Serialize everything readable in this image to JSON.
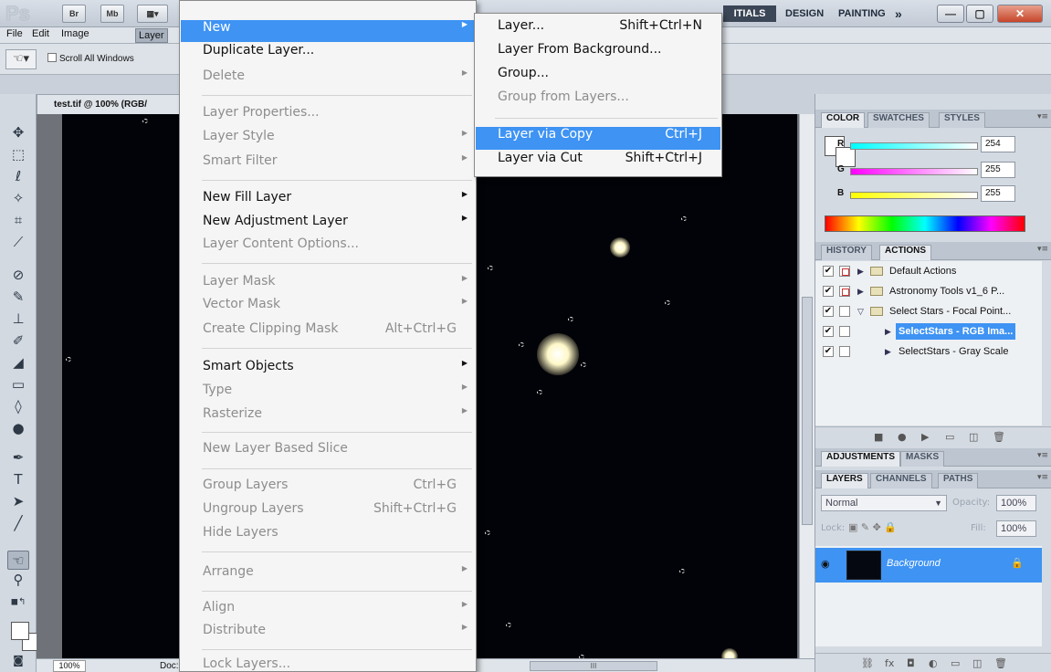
{
  "app": {
    "logo": "Ps",
    "bridge_label": "Br",
    "minibridge_label": "Mb",
    "workspaces": {
      "essentials": "ITIALS",
      "design": "DESIGN",
      "painting": "PAINTING",
      "more": "»"
    },
    "window_buttons": {
      "minimize": "—",
      "restore": "▢",
      "close": "✕"
    }
  },
  "menubar": {
    "items": [
      {
        "label": "File"
      },
      {
        "label": "Edit"
      },
      {
        "label": "Image"
      },
      {
        "label": "Layer"
      }
    ]
  },
  "options": {
    "scroll_all_windows": "Scroll All Windows"
  },
  "document": {
    "tab_title": "test.tif @ 100% (RGB/",
    "zoom": "100%",
    "doc_label": "Doc:",
    "scroll_label": "III"
  },
  "layer_menu": {
    "items": [
      {
        "label": "New",
        "enabled": true,
        "submenu": true,
        "highlighted": true
      },
      {
        "label": "Duplicate Layer...",
        "enabled": true
      },
      {
        "label": "Delete",
        "enabled": false,
        "submenu": true
      },
      {
        "label": "Layer Properties...",
        "enabled": false
      },
      {
        "label": "Layer Style",
        "enabled": false,
        "submenu": true
      },
      {
        "label": "Smart Filter",
        "enabled": false,
        "submenu": true
      },
      {
        "label": "New Fill Layer",
        "enabled": true,
        "submenu": true
      },
      {
        "label": "New Adjustment Layer",
        "enabled": true,
        "submenu": true
      },
      {
        "label": "Layer Content Options...",
        "enabled": false
      },
      {
        "label": "Layer Mask",
        "enabled": false,
        "submenu": true
      },
      {
        "label": "Vector Mask",
        "enabled": false,
        "submenu": true
      },
      {
        "label": "Create Clipping Mask",
        "enabled": false,
        "shortcut": "Alt+Ctrl+G"
      },
      {
        "label": "Smart Objects",
        "enabled": true,
        "submenu": true
      },
      {
        "label": "Type",
        "enabled": false,
        "submenu": true
      },
      {
        "label": "Rasterize",
        "enabled": false,
        "submenu": true
      },
      {
        "label": "New Layer Based Slice",
        "enabled": false
      },
      {
        "label": "Group Layers",
        "enabled": false,
        "shortcut": "Ctrl+G"
      },
      {
        "label": "Ungroup Layers",
        "enabled": false,
        "shortcut": "Shift+Ctrl+G"
      },
      {
        "label": "Hide Layers",
        "enabled": false
      },
      {
        "label": "Arrange",
        "enabled": false,
        "submenu": true
      },
      {
        "label": "Align",
        "enabled": false,
        "submenu": true
      },
      {
        "label": "Distribute",
        "enabled": false,
        "submenu": true
      },
      {
        "label": "Lock Layers...",
        "enabled": false
      }
    ]
  },
  "new_submenu": {
    "items": [
      {
        "label": "Layer...",
        "shortcut": "Shift+Ctrl+N",
        "enabled": true
      },
      {
        "label": "Layer From Background...",
        "enabled": true
      },
      {
        "label": "Group...",
        "enabled": true
      },
      {
        "label": "Group from Layers...",
        "enabled": false
      },
      {
        "label": "Layer via Copy",
        "shortcut": "Ctrl+J",
        "enabled": true,
        "highlighted": true
      },
      {
        "label": "Layer via Cut",
        "shortcut": "Shift+Ctrl+J",
        "enabled": true
      }
    ]
  },
  "color_panel": {
    "tabs": [
      "COLOR",
      "SWATCHES",
      "STYLES"
    ],
    "r": {
      "label": "R",
      "value": "254"
    },
    "g": {
      "label": "G",
      "value": "255"
    },
    "b": {
      "label": "B",
      "value": "255"
    }
  },
  "actions_panel": {
    "tabs": [
      "HISTORY",
      "ACTIONS"
    ],
    "rows": [
      {
        "label": "Default Actions"
      },
      {
        "label": "Astronomy Tools v1_6 P..."
      },
      {
        "label": "Select Stars - Focal Point..."
      },
      {
        "label": "SelectStars - RGB Ima..."
      },
      {
        "label": "SelectStars - Gray Scale"
      }
    ]
  },
  "adjustments_panel": {
    "tabs": [
      "ADJUSTMENTS",
      "MASKS"
    ]
  },
  "layers_panel": {
    "tabs": [
      "LAYERS",
      "CHANNELS",
      "PATHS"
    ],
    "blend_mode": "Normal",
    "opacity_label": "Opacity:",
    "opacity_value": "100%",
    "lock_label": "Lock:",
    "fill_label": "Fill:",
    "fill_value": "100%",
    "layer_name": "Background"
  },
  "colors": {
    "accent": "#3e93f3",
    "canvas": "#020308"
  }
}
